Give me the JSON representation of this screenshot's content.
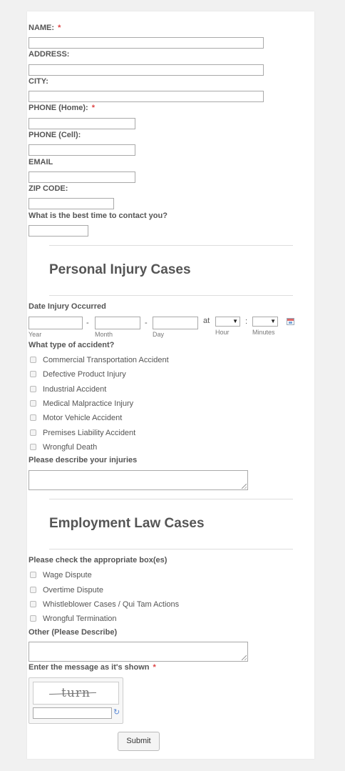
{
  "contact": {
    "name_label": "NAME:",
    "address_label": "ADDRESS:",
    "city_label": "CITY:",
    "phone_home_label": "PHONE (Home):",
    "phone_cell_label": "PHONE (Cell):",
    "email_label": "EMAIL",
    "zip_label": "ZIP CODE:",
    "best_time_label": "What is the best time to contact you?",
    "required_marker": "*"
  },
  "personal_injury": {
    "title": "Personal Injury Cases",
    "date_label": "Date Injury Occurred",
    "date_separator": "-",
    "at_label": "at",
    "time_separator": ":",
    "year_label": "Year",
    "month_label": "Month",
    "day_label": "Day",
    "hour_label": "Hour",
    "minutes_label": "Minutes",
    "accident_type_label": "What type of accident?",
    "accident_types": [
      "Commercial Transportation Accident",
      "Defective Product Injury",
      "Industrial Accident",
      "Medical Malpractice Injury",
      "Motor Vehicle Accident",
      "Premises Liability Accident",
      "Wrongful Death"
    ],
    "describe_label": "Please describe your injuries"
  },
  "employment": {
    "title": "Employment Law Cases",
    "check_label": "Please check the appropriate box(es)",
    "case_types": [
      "Wage Dispute",
      "Overtime Dispute",
      "Whistleblower Cases / Qui Tam Actions",
      "Wrongful Termination"
    ],
    "other_label": "Other (Please Describe)"
  },
  "captcha": {
    "label": "Enter the message as it's shown",
    "image_text": "turn",
    "refresh_glyph": "↻"
  },
  "submit_label": "Submit",
  "icons": {
    "dropdown": "▼"
  }
}
